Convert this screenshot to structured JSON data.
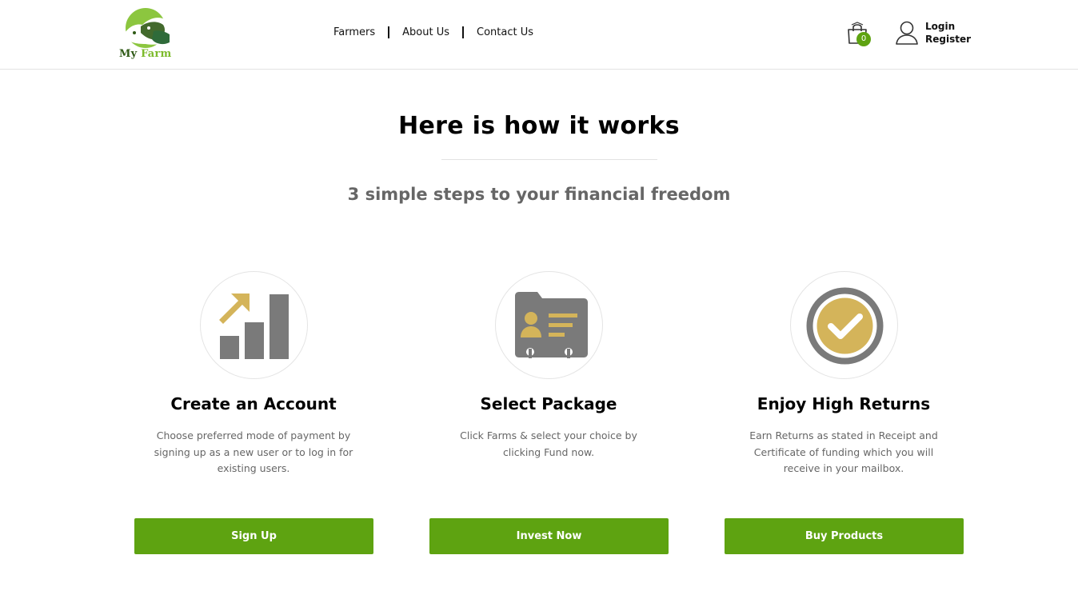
{
  "brand": {
    "logo_text_my": "My",
    "logo_text_farm": "Farm"
  },
  "nav": {
    "items": [
      {
        "label": "Farmers"
      },
      {
        "label": "About Us"
      },
      {
        "label": "Contact Us"
      }
    ]
  },
  "header": {
    "cart_count": "0",
    "login_label": "Login",
    "register_label": "Register"
  },
  "hero": {
    "title": "Here is how it works",
    "subtitle": "3 simple steps to your financial freedom"
  },
  "steps": [
    {
      "icon": "growth-chart-icon",
      "title": "Create an Account",
      "description": "Choose preferred mode of payment by signing up as a new user or to log in for existing users.",
      "button_label": "Sign Up"
    },
    {
      "icon": "id-card-folder-icon",
      "title": "Select Package",
      "description": "Click Farms & select your choice by clicking Fund now.",
      "button_label": "Invest Now"
    },
    {
      "icon": "check-badge-icon",
      "title": "Enjoy High Returns",
      "description": "Earn Returns as stated in Receipt and Certificate of funding which you will receive in your mailbox.",
      "button_label": "Buy Products"
    }
  ],
  "colors": {
    "brand_green": "#5ea311",
    "logo_dark_green": "#2f5a16",
    "logo_light_green": "#7dbb2c",
    "icon_gold": "#d4b45a",
    "icon_gray": "#7a7a7a"
  }
}
